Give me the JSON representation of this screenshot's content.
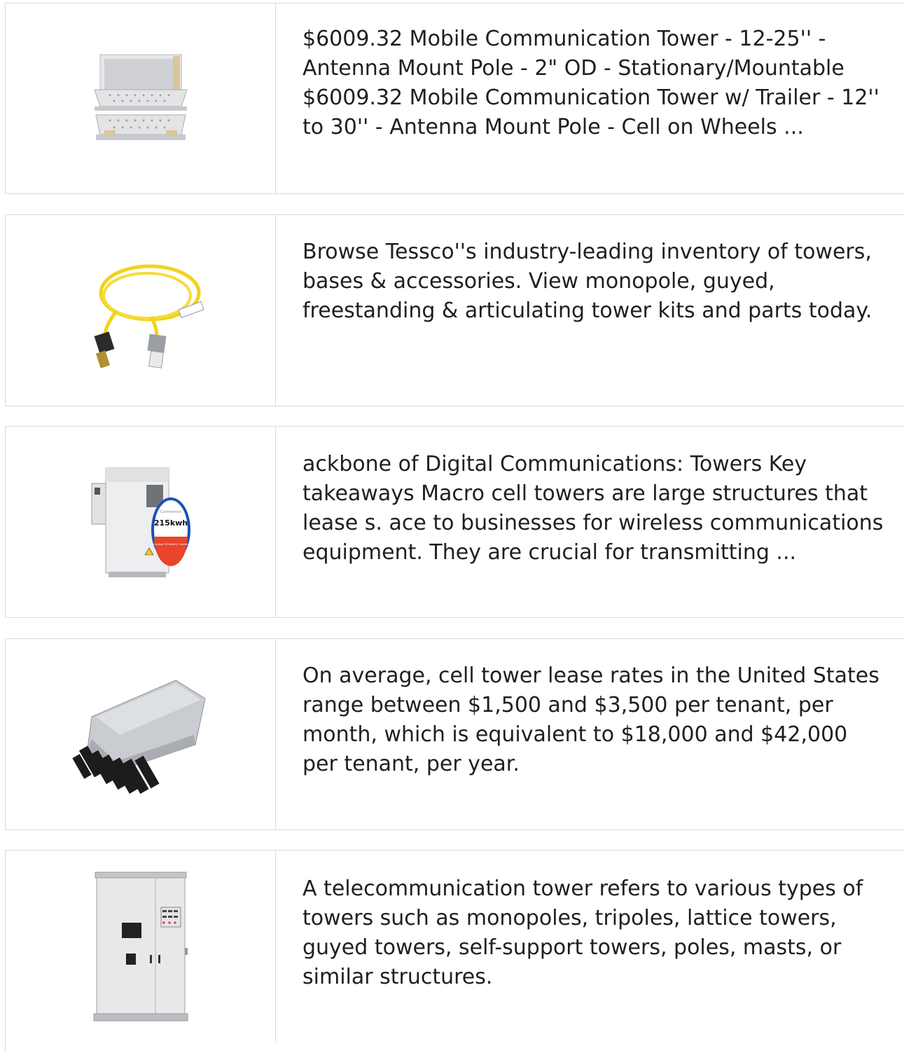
{
  "results": [
    {
      "image": "server-rack-shelf-drawers",
      "text": "$6009.32 Mobile Communication Tower - 12-25'' - Antenna Mount Pole - 2\" OD - Stationary/Mountable $6009.32 Mobile Communication Tower w/ Trailer - 12'' to 30'' - Antenna Mount Pole - Cell on Wheels ..."
    },
    {
      "image": "fiber-optic-patch-cord",
      "text": "Browse Tessco''s industry-leading inventory of towers, bases & accessories. View monopole, guyed, freestanding & articulating tower kits and parts today."
    },
    {
      "image": "outdoor-battery-cabinet",
      "badge_top": "Commercial",
      "badge_value": "215kwh",
      "badge_bottom": "Outdoor DC Battery Cabinet",
      "text": "ackbone of Digital Communications: Towers Key takeaways Macro cell towers are large structures that lease s. ace to businesses for wireless communications equipment. They are crucial for transmitting ..."
    },
    {
      "image": "fiber-distribution-box",
      "text": "On average, cell tower lease rates in the United States range between $1,500 and $3,500 per tenant, per month, which is equivalent to $18,000 and $42,000 per tenant, per year."
    },
    {
      "image": "electrical-control-cabinet",
      "text": "A telecommunication tower refers to various types of towers such as monopoles, tripoles, lattice towers, guyed towers, self-support towers, poles, masts, or similar structures."
    }
  ],
  "colors": {
    "border": "#d9d9d9",
    "text": "#1f1f1f",
    "badge_blue": "#1d4fb4",
    "badge_red": "#e8452a"
  }
}
